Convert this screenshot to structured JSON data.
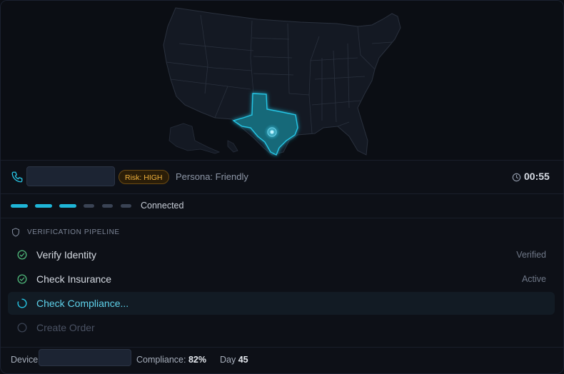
{
  "call": {
    "risk_label": "Risk: HIGH",
    "persona": "Persona: Friendly",
    "timer": "00:55"
  },
  "connection": {
    "segments_total": 6,
    "segments_active": 3,
    "status": "Connected"
  },
  "pipeline": {
    "title": "VERIFICATION PIPELINE",
    "steps": [
      {
        "name": "Verify Identity",
        "status": "Verified",
        "state": "done"
      },
      {
        "name": "Check Insurance",
        "status": "Active",
        "state": "done"
      },
      {
        "name": "Check Compliance...",
        "status": "",
        "state": "active"
      },
      {
        "name": "Create Order",
        "status": "",
        "state": "pending"
      }
    ]
  },
  "footer": {
    "device_label": "Device",
    "compliance_label": "Compliance:",
    "compliance_value": "82%",
    "day_label": "Day",
    "day_value": "45"
  },
  "map": {
    "highlighted_state": "Texas"
  },
  "colors": {
    "accent": "#1fb6d8",
    "risk": "#f2b33d",
    "success": "#4fb87a",
    "background": "#0d1017"
  },
  "icons": [
    "phone-icon",
    "clock-icon",
    "shield-icon",
    "check-circle-icon",
    "spinner-icon",
    "empty-circle-icon"
  ]
}
